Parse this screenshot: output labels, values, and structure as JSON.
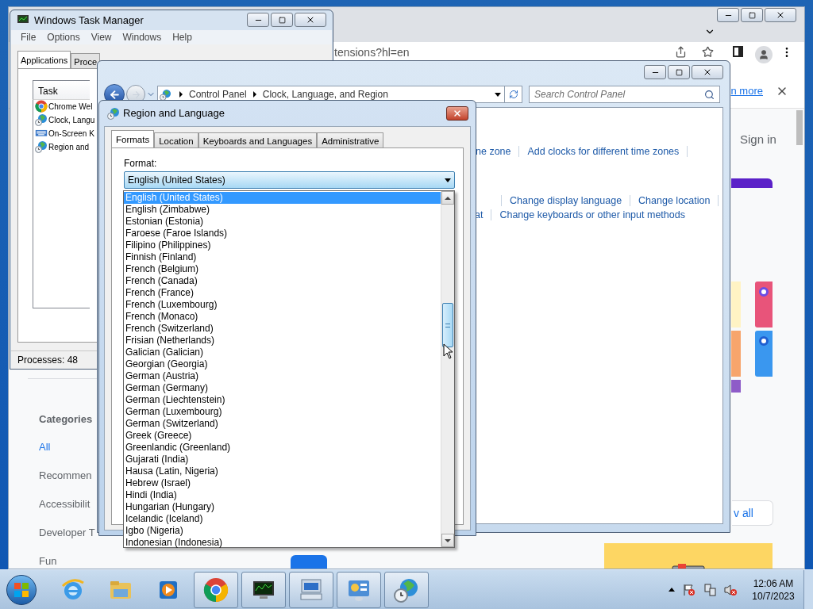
{
  "browser": {
    "url_fragment": "tensions?hl=en",
    "banner_link": "n more",
    "sign_in": "Sign in",
    "categories_heading": "Categories",
    "categories": [
      {
        "label": "All",
        "selected": true
      },
      {
        "label": "Recommen",
        "selected": false
      },
      {
        "label": "Accessibilit",
        "selected": false
      },
      {
        "label": "Developer T",
        "selected": false
      },
      {
        "label": "Fun",
        "selected": false
      }
    ],
    "view_all": "v all"
  },
  "task_manager": {
    "title": "Windows Task Manager",
    "menu": [
      "File",
      "Options",
      "View",
      "Windows",
      "Help"
    ],
    "tabs": [
      {
        "label": "Applications",
        "selected": true
      },
      {
        "label": "Proce",
        "selected": false
      }
    ],
    "column": "Task",
    "tasks": [
      {
        "name": "Chrome Wel",
        "kind": "chrome"
      },
      {
        "name": "Clock, Langu",
        "kind": "globe-clock"
      },
      {
        "name": "On-Screen K",
        "kind": "keyboard"
      },
      {
        "name": "Region and",
        "kind": "globe-clock"
      }
    ],
    "status": "Processes: 48"
  },
  "control_panel": {
    "breadcrumb": [
      "Control Panel",
      "Clock, Language, and Region"
    ],
    "search_placeholder": "Search Control Panel",
    "link_rows": [
      [
        "ne zone",
        "Add clocks for different time zones"
      ],
      [
        "",
        "Change display language",
        "Change location"
      ],
      [
        "at",
        "Change keyboards or other input methods"
      ]
    ]
  },
  "dialog": {
    "title": "Region and Language",
    "tabs": [
      {
        "label": "Formats",
        "selected": true
      },
      {
        "label": "Location",
        "selected": false
      },
      {
        "label": "Keyboards and Languages",
        "selected": false
      },
      {
        "label": "Administrative",
        "selected": false
      }
    ],
    "format_label": "Format:",
    "format_value": "English (United States)",
    "options": [
      {
        "label": "English (United States)",
        "selected": true
      },
      {
        "label": "English (Zimbabwe)",
        "selected": false
      },
      {
        "label": "Estonian (Estonia)",
        "selected": false
      },
      {
        "label": "Faroese (Faroe Islands)",
        "selected": false
      },
      {
        "label": "Filipino (Philippines)",
        "selected": false
      },
      {
        "label": "Finnish (Finland)",
        "selected": false
      },
      {
        "label": "French (Belgium)",
        "selected": false
      },
      {
        "label": "French (Canada)",
        "selected": false
      },
      {
        "label": "French (France)",
        "selected": false
      },
      {
        "label": "French (Luxembourg)",
        "selected": false
      },
      {
        "label": "French (Monaco)",
        "selected": false
      },
      {
        "label": "French (Switzerland)",
        "selected": false
      },
      {
        "label": "Frisian (Netherlands)",
        "selected": false
      },
      {
        "label": "Galician (Galician)",
        "selected": false
      },
      {
        "label": "Georgian (Georgia)",
        "selected": false
      },
      {
        "label": "German (Austria)",
        "selected": false
      },
      {
        "label": "German (Germany)",
        "selected": false
      },
      {
        "label": "German (Liechtenstein)",
        "selected": false
      },
      {
        "label": "German (Luxembourg)",
        "selected": false
      },
      {
        "label": "German (Switzerland)",
        "selected": false
      },
      {
        "label": "Greek (Greece)",
        "selected": false
      },
      {
        "label": "Greenlandic (Greenland)",
        "selected": false
      },
      {
        "label": "Gujarati (India)",
        "selected": false
      },
      {
        "label": "Hausa (Latin, Nigeria)",
        "selected": false
      },
      {
        "label": "Hebrew (Israel)",
        "selected": false
      },
      {
        "label": "Hindi (India)",
        "selected": false
      },
      {
        "label": "Hungarian (Hungary)",
        "selected": false
      },
      {
        "label": "Icelandic (Iceland)",
        "selected": false
      },
      {
        "label": "Igbo (Nigeria)",
        "selected": false
      },
      {
        "label": "Indonesian (Indonesia)",
        "selected": false
      }
    ]
  },
  "taskbar": {
    "apps": [
      {
        "kind": "ie",
        "open": false
      },
      {
        "kind": "folder",
        "open": false
      },
      {
        "kind": "media",
        "open": false
      },
      {
        "kind": "chrome",
        "open": true
      },
      {
        "kind": "taskmgr",
        "open": true
      },
      {
        "kind": "keyboard",
        "open": true
      },
      {
        "kind": "control",
        "open": true
      },
      {
        "kind": "globe-clock",
        "open": true
      }
    ],
    "time": "12:06 AM",
    "date": "10/7/2023"
  }
}
